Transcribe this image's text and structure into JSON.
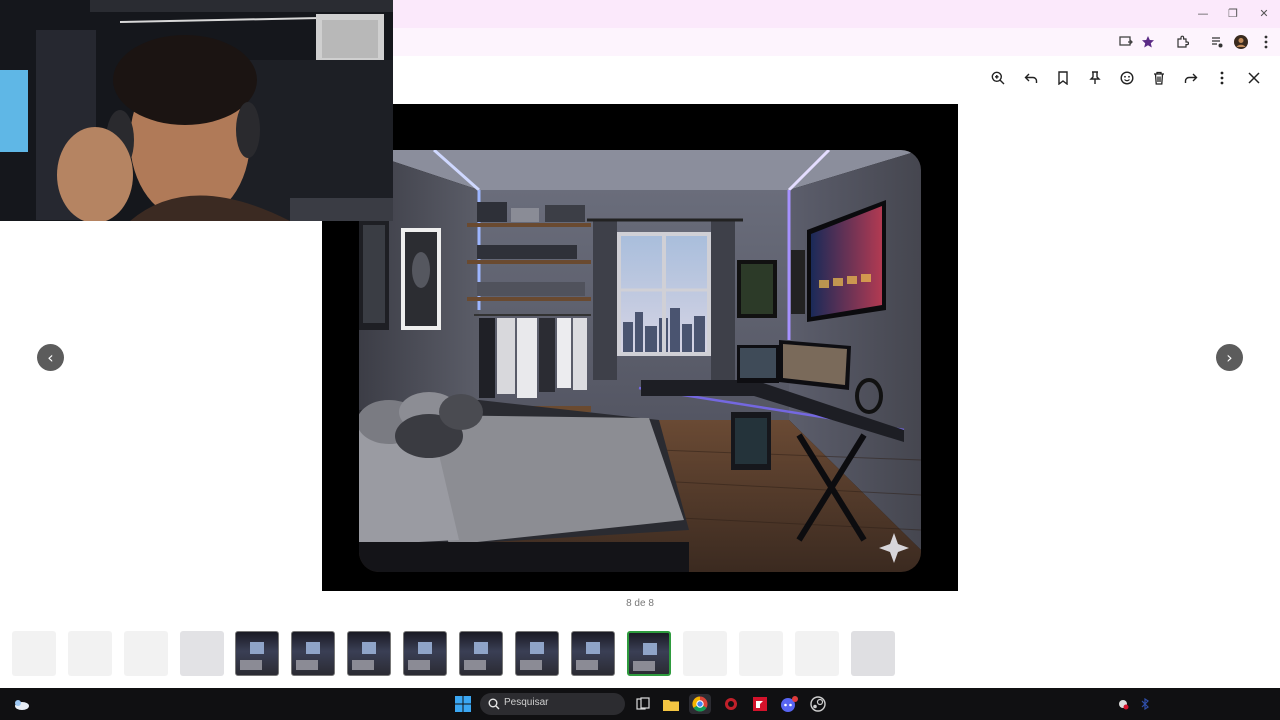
{
  "viewer": {
    "counter": "8 de 8",
    "actions": [
      "zoom-in",
      "reply",
      "bookmark",
      "pin",
      "react",
      "delete",
      "forward",
      "more",
      "close"
    ],
    "nav_prev": "‹",
    "nav_next": "›"
  },
  "window_controls": {
    "minimize": "—",
    "restore": "❐",
    "close": "✕"
  },
  "filmstrip": {
    "total_visible": 16,
    "selected_index": 8
  },
  "taskbar": {
    "search_placeholder": "Pesquisar"
  },
  "colors": {
    "titlebar": "#fbe9fb",
    "accent_selected": "#2e9b3e",
    "taskbar": "#101012",
    "led": "#7c6cff"
  }
}
